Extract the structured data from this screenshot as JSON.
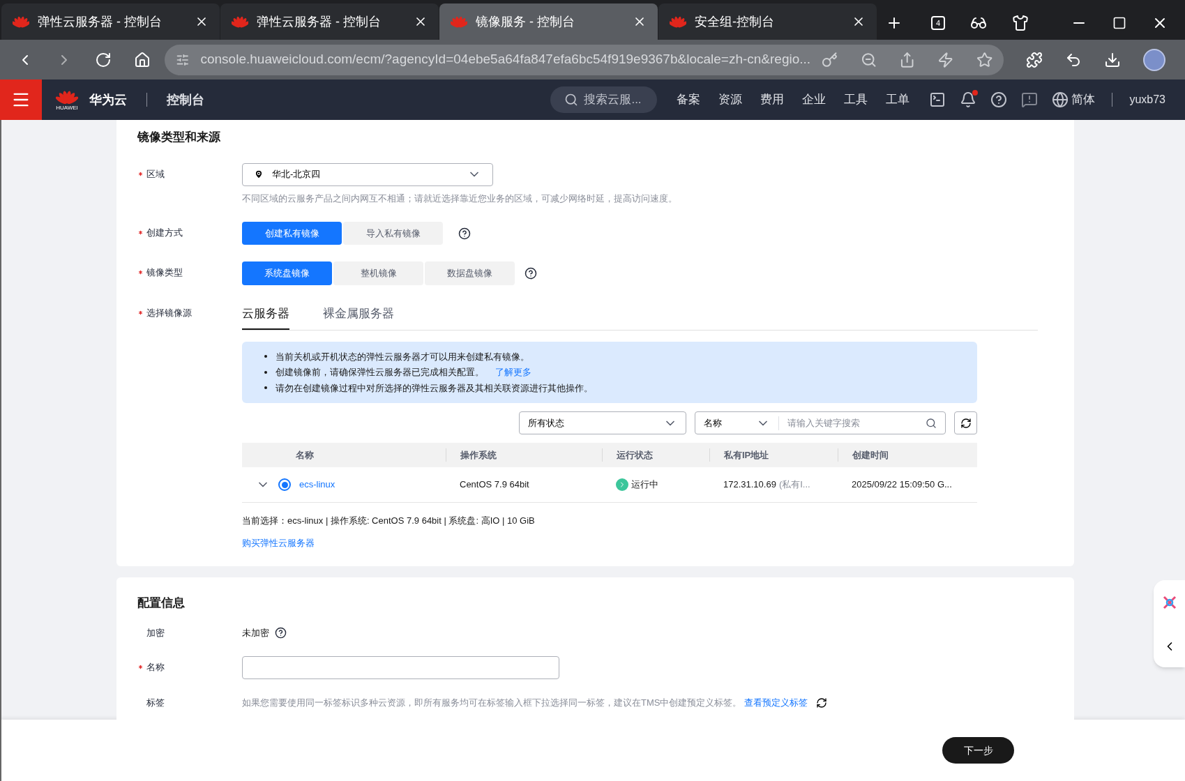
{
  "browser": {
    "tabs": [
      {
        "title": "弹性云服务器 - 控制台",
        "selected": false
      },
      {
        "title": "弹性云服务器 - 控制台",
        "selected": false
      },
      {
        "title": "镜像服务 - 控制台",
        "selected": true
      },
      {
        "title": "安全组-控制台",
        "selected": false
      }
    ],
    "tab_count": "4",
    "url": "console.huaweicloud.com/ecm/?agencyId=04ebe5a64fa847efa6bc54f919e9367b&locale=zh-cn&regio..."
  },
  "topnav": {
    "logo_text": "HUAWEI",
    "brand": "华为云",
    "console": "控制台",
    "search_placeholder": "搜索云服...",
    "links": [
      "备案",
      "资源",
      "费用",
      "企业",
      "工具",
      "工单"
    ],
    "language": "简体",
    "user": "yuxb73"
  },
  "source_section": {
    "title": "镜像类型和来源",
    "region": {
      "label": "区域",
      "required": true,
      "value": "华北-北京四",
      "hint": "不同区域的云服务产品之间内网互不相通；请就近选择靠近您业务的区域，可减少网络时延，提高访问速度。"
    },
    "create_method": {
      "label": "创建方式",
      "required": true,
      "options": [
        {
          "label": "创建私有镜像",
          "selected": true
        },
        {
          "label": "导入私有镜像",
          "selected": false
        }
      ]
    },
    "image_type": {
      "label": "镜像类型",
      "required": true,
      "options": [
        {
          "label": "系统盘镜像",
          "selected": true
        },
        {
          "label": "整机镜像",
          "selected": false
        },
        {
          "label": "数据盘镜像",
          "selected": false
        }
      ]
    },
    "image_source": {
      "label": "选择镜像源",
      "required": true,
      "tabs": [
        {
          "label": "云服务器",
          "selected": true
        },
        {
          "label": "裸金属服务器",
          "selected": false
        }
      ],
      "notices": [
        "当前关机或开机状态的弹性云服务器才可以用来创建私有镜像。",
        "创建镜像前，请确保弹性云服务器已完成相关配置。",
        "请勿在创建镜像过程中对所选择的弹性云服务器及其相关联资源进行其他操作。"
      ],
      "notice_link": "了解更多",
      "status_filter": "所有状态",
      "search_field": "名称",
      "search_placeholder": "请输入关键字搜索",
      "table": {
        "columns": [
          "名称",
          "操作系统",
          "运行状态",
          "私有IP地址",
          "创建时间"
        ],
        "rows": [
          {
            "name": "ecs-linux",
            "selected": true,
            "os": "CentOS 7.9 64bit",
            "status": "运行中",
            "ip": "172.31.10.69",
            "ip_note": "(私有I...",
            "created": "2025/09/22 15:09:50 G..."
          }
        ]
      },
      "current_selection": "当前选择：ecs-linux | 操作系统: CentOS 7.9 64bit | 系统盘: 高IO | 10 GiB",
      "buy_link": "购买弹性云服务器"
    }
  },
  "config_section": {
    "title": "配置信息",
    "encryption": {
      "label": "加密",
      "required": false,
      "value": "未加密"
    },
    "name": {
      "label": "名称",
      "required": true
    },
    "tags": {
      "label": "标签",
      "required": false,
      "hint": "如果您需要使用同一标签标识多种云资源，即所有服务均可在标签输入框下拉选择同一标签，建议在TMS中创建预定义标签。",
      "link": "查看预定义标签"
    }
  },
  "footer": {
    "next_button": "下一步"
  }
}
